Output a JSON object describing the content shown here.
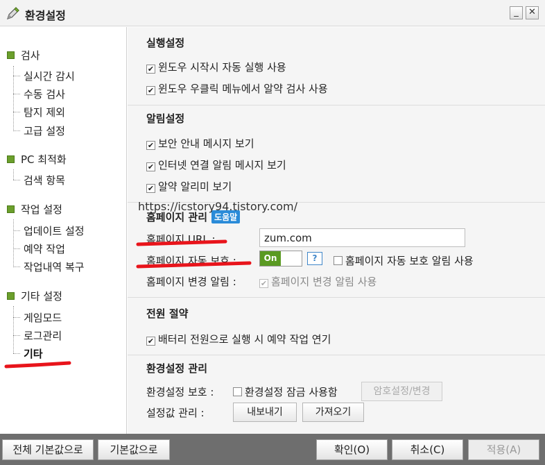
{
  "window": {
    "title": "환경설정",
    "minimize_glyph": "_",
    "close_glyph": "✕",
    "icon": "pencil-icon"
  },
  "sidebar": {
    "categories": [
      {
        "label": "검사",
        "items": [
          "실시간 감시",
          "수동 검사",
          "탐지 제외",
          "고급 설정"
        ]
      },
      {
        "label": "PC 최적화",
        "items": [
          "검색 항목"
        ]
      },
      {
        "label": "작업 설정",
        "items": [
          "업데이트 설정",
          "예약 작업",
          "작업내역 복구"
        ]
      },
      {
        "label": "기타 설정",
        "items": [
          "게임모드",
          "로그관리",
          "기타"
        ]
      }
    ],
    "active_item": "기타"
  },
  "sections": {
    "run": {
      "title": "실행설정",
      "options": [
        {
          "label": "윈도우 시작시 자동 실행 사용",
          "checked": true
        },
        {
          "label": "윈도우 우클릭 메뉴에서 알약 검사 사용",
          "checked": true
        }
      ]
    },
    "alert": {
      "title": "알림설정",
      "options": [
        {
          "label": "보안 안내 메시지 보기",
          "checked": true
        },
        {
          "label": "인터넷 연결 알림 메시지 보기",
          "checked": true
        },
        {
          "label": "알약 알리미 보기",
          "checked": true
        }
      ]
    },
    "homepage": {
      "title": "홈페이지 관리",
      "help_label": "도움말",
      "url_label": "홈페이지 URL :",
      "url_value": "zum.com",
      "protect_label": "홈페이지 자동 보호 :",
      "toggle_state": "On",
      "question_glyph": "?",
      "protect_alert_label": "홈페이지 자동 보호 알림 사용",
      "protect_alert_checked": false,
      "change_label": "홈페이지 변경 알림 :",
      "change_option_label": "홈페이지 변경 알림 사용",
      "change_option_checked": true
    },
    "power": {
      "title": "전원 절약",
      "options": [
        {
          "label": "배터리 전원으로 실행 시 예약 작업 연기",
          "checked": true
        }
      ]
    },
    "config": {
      "title": "환경설정 관리",
      "protect_label": "환경설정 보호 :",
      "lock_label": "환경설정 잠금 사용함",
      "lock_checked": false,
      "password_button": "암호설정/변경",
      "values_label": "설정값 관리 :",
      "export_button": "내보내기",
      "import_button": "가져오기"
    }
  },
  "footer": {
    "reset_all": "전체 기본값으로",
    "reset": "기본값으로",
    "ok": "확인(O)",
    "cancel": "취소(C)",
    "apply": "적용(A)"
  },
  "overlay": {
    "watermark": "https://icstory94.tistory.com/",
    "annotation_color": "#e8141b"
  },
  "colors": {
    "accent_green": "#5a9a22",
    "help_blue": "#2a8bd8",
    "panel_bg": "#f5f5f5",
    "footer_bg": "#6e6e6e"
  }
}
